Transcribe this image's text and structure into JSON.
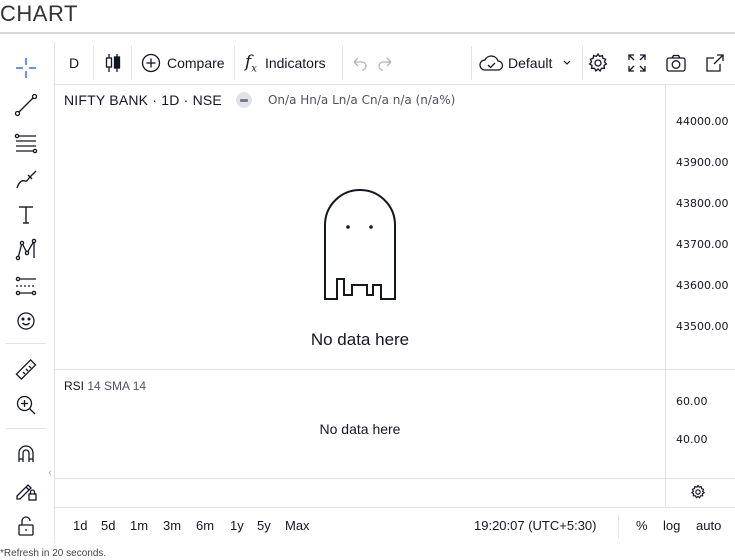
{
  "page": {
    "title": "CHART",
    "footnote": "*Refresh in 20 seconds."
  },
  "top_toolbar": {
    "interval": "D",
    "compare_label": "Compare",
    "indicators_label": "Indicators",
    "layout_label": "Default"
  },
  "legend": {
    "symbol": "NIFTY BANK · 1D · NSE",
    "ohlc": "On/a Hn/a Ln/a Cn/a n/a (n/a%)"
  },
  "main_pane": {
    "no_data": "No data here",
    "price_ticks": [
      "44000.00",
      "43900.00",
      "43800.00",
      "43700.00",
      "43600.00",
      "43500.00"
    ]
  },
  "rsi_pane": {
    "name": "RSI",
    "params": "14 SMA 14",
    "no_data": "No data here",
    "ticks": [
      "60.00",
      "40.00"
    ]
  },
  "bottom_toolbar": {
    "ranges": [
      "1d",
      "5d",
      "1m",
      "3m",
      "6m",
      "1y",
      "5y",
      "Max"
    ],
    "clock": "19:20:07 (UTC+5:30)",
    "percent_label": "%",
    "log_label": "log",
    "auto_label": "auto"
  },
  "icons": {
    "left_toolbar": [
      "crosshair-icon",
      "trend-line-icon",
      "fib-retracement-icon",
      "brush-icon",
      "text-icon",
      "pattern-icon",
      "prediction-icon",
      "emoji-icon",
      "ruler-icon",
      "zoom-in-icon",
      "magnet-icon",
      "lock-drawing-icon",
      "lock-icon"
    ],
    "top_toolbar": [
      "candles-icon",
      "compare-plus-icon",
      "indicators-fx-icon",
      "undo-icon",
      "redo-icon",
      "cloud-save-icon",
      "chevron-down-icon",
      "settings-gear-icon",
      "fullscreen-icon",
      "camera-icon",
      "popout-icon"
    ]
  },
  "colors": {
    "accent": "#2962ff",
    "text": "#131722",
    "border": "#e0e3eb",
    "muted": "#787b86"
  }
}
